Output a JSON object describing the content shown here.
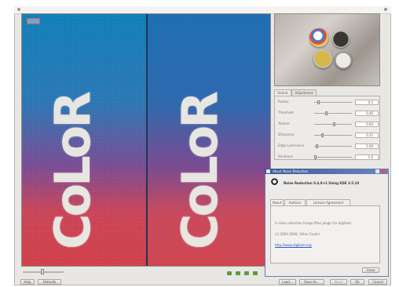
{
  "settings_tabs": [
    "Details",
    "Adjustment"
  ],
  "settings_rows": [
    {
      "label": "Radius",
      "value": "0.5"
    },
    {
      "label": "Threshold",
      "value": "0.46"
    },
    {
      "label": "Texture",
      "value": "0.00"
    },
    {
      "label": "Sharpness",
      "value": "0.25"
    },
    {
      "label": "Edge Luminance",
      "value": "1.00"
    },
    {
      "label": "Iterations",
      "value": "1.0"
    }
  ],
  "dialog": {
    "title": "About Noise Reduction",
    "heading": "Noise Reduction 0.4.0-r1 Using KDE 3.5.10",
    "tabs": [
      "About",
      "Authors",
      "License Agreement"
    ],
    "line1": "A noise reduction image filter plugin for digiKam.",
    "line2": "(c) 2004-2008, Gilles Caulier",
    "link": "http://www.digikam.org",
    "close_label": "Close"
  },
  "bottom_buttons": {
    "help": "Help",
    "defaults": "Defaults",
    "load": "Load...",
    "save_as": "Save As...",
    "abort": "Abort",
    "ok": "Ok",
    "cancel": "Cancel"
  },
  "colors": {
    "accent": "#3e5a96",
    "nav_green": "#5a9d3a"
  }
}
